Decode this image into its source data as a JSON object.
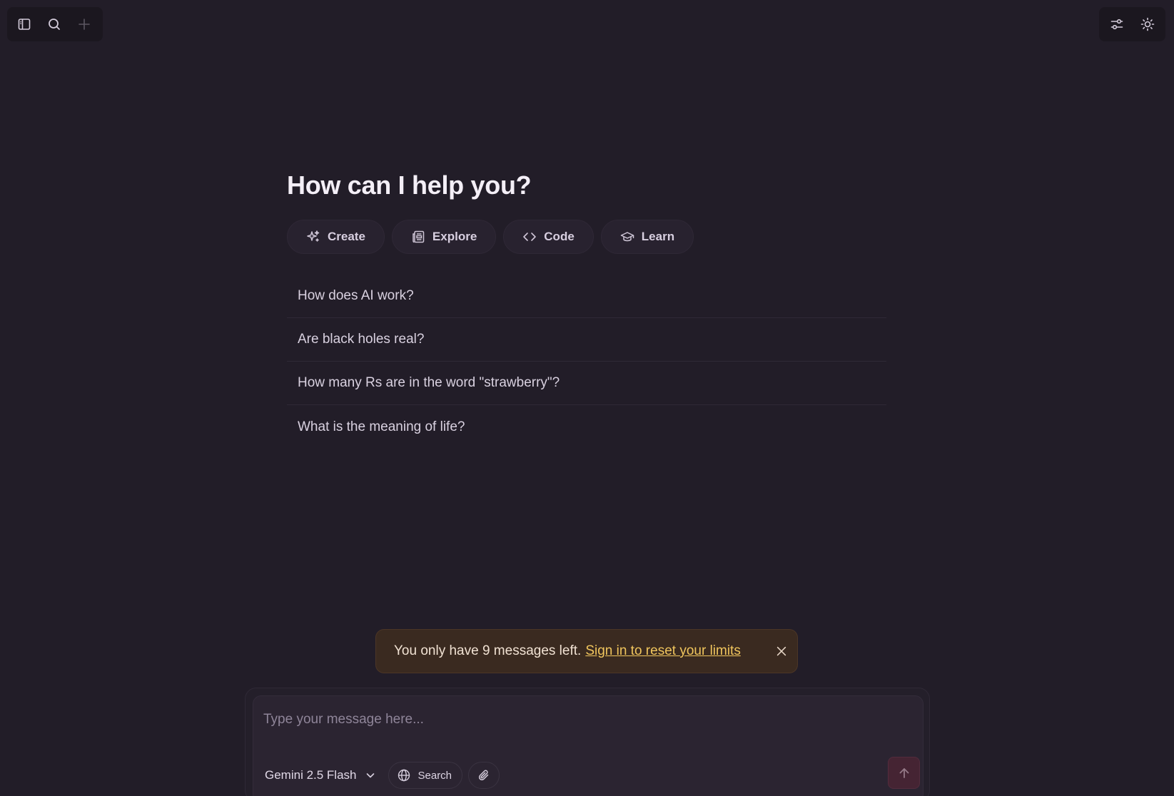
{
  "toolbar": {
    "left_icons": [
      "sidebar-toggle-icon",
      "search-icon",
      "plus-icon"
    ],
    "right_icons": [
      "settings-sliders-icon",
      "sun-icon"
    ]
  },
  "main": {
    "heading": "How can I help you?",
    "categories": [
      {
        "label": "Create",
        "icon": "sparkles-icon"
      },
      {
        "label": "Explore",
        "icon": "newspaper-icon"
      },
      {
        "label": "Code",
        "icon": "code-icon"
      },
      {
        "label": "Learn",
        "icon": "graduation-cap-icon"
      }
    ],
    "suggestions": [
      "How does AI work?",
      "Are black holes real?",
      "How many Rs are in the word \"strawberry\"?",
      "What is the meaning of life?"
    ]
  },
  "banner": {
    "text": "You only have 9 messages left.",
    "link": "Sign in to reset your limits"
  },
  "composer": {
    "placeholder": "Type your message here...",
    "model": "Gemini 2.5 Flash",
    "search_label": "Search"
  },
  "colors": {
    "background": "#221d28",
    "banner_bg": "#3a2a20",
    "banner_link": "#f0c55d",
    "send_button": "#4a2534"
  }
}
